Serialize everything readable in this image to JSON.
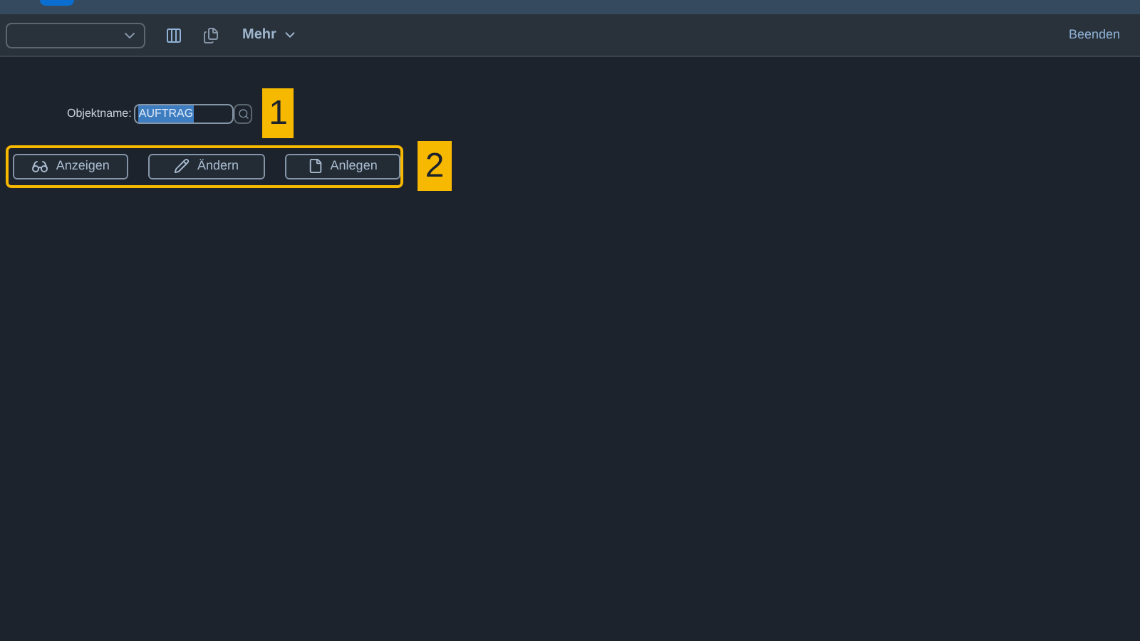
{
  "toolbar": {
    "more_menu": "Mehr",
    "exit": "Beenden"
  },
  "form": {
    "label": "Objektname:",
    "value": "AUFTRAG",
    "value_selected": true
  },
  "buttons": [
    {
      "kind": "display",
      "label": "Anzeigen"
    },
    {
      "kind": "edit",
      "label": "Ändern"
    },
    {
      "kind": "create",
      "label": "Anlegen"
    }
  ],
  "callouts": [
    "1",
    "2"
  ]
}
